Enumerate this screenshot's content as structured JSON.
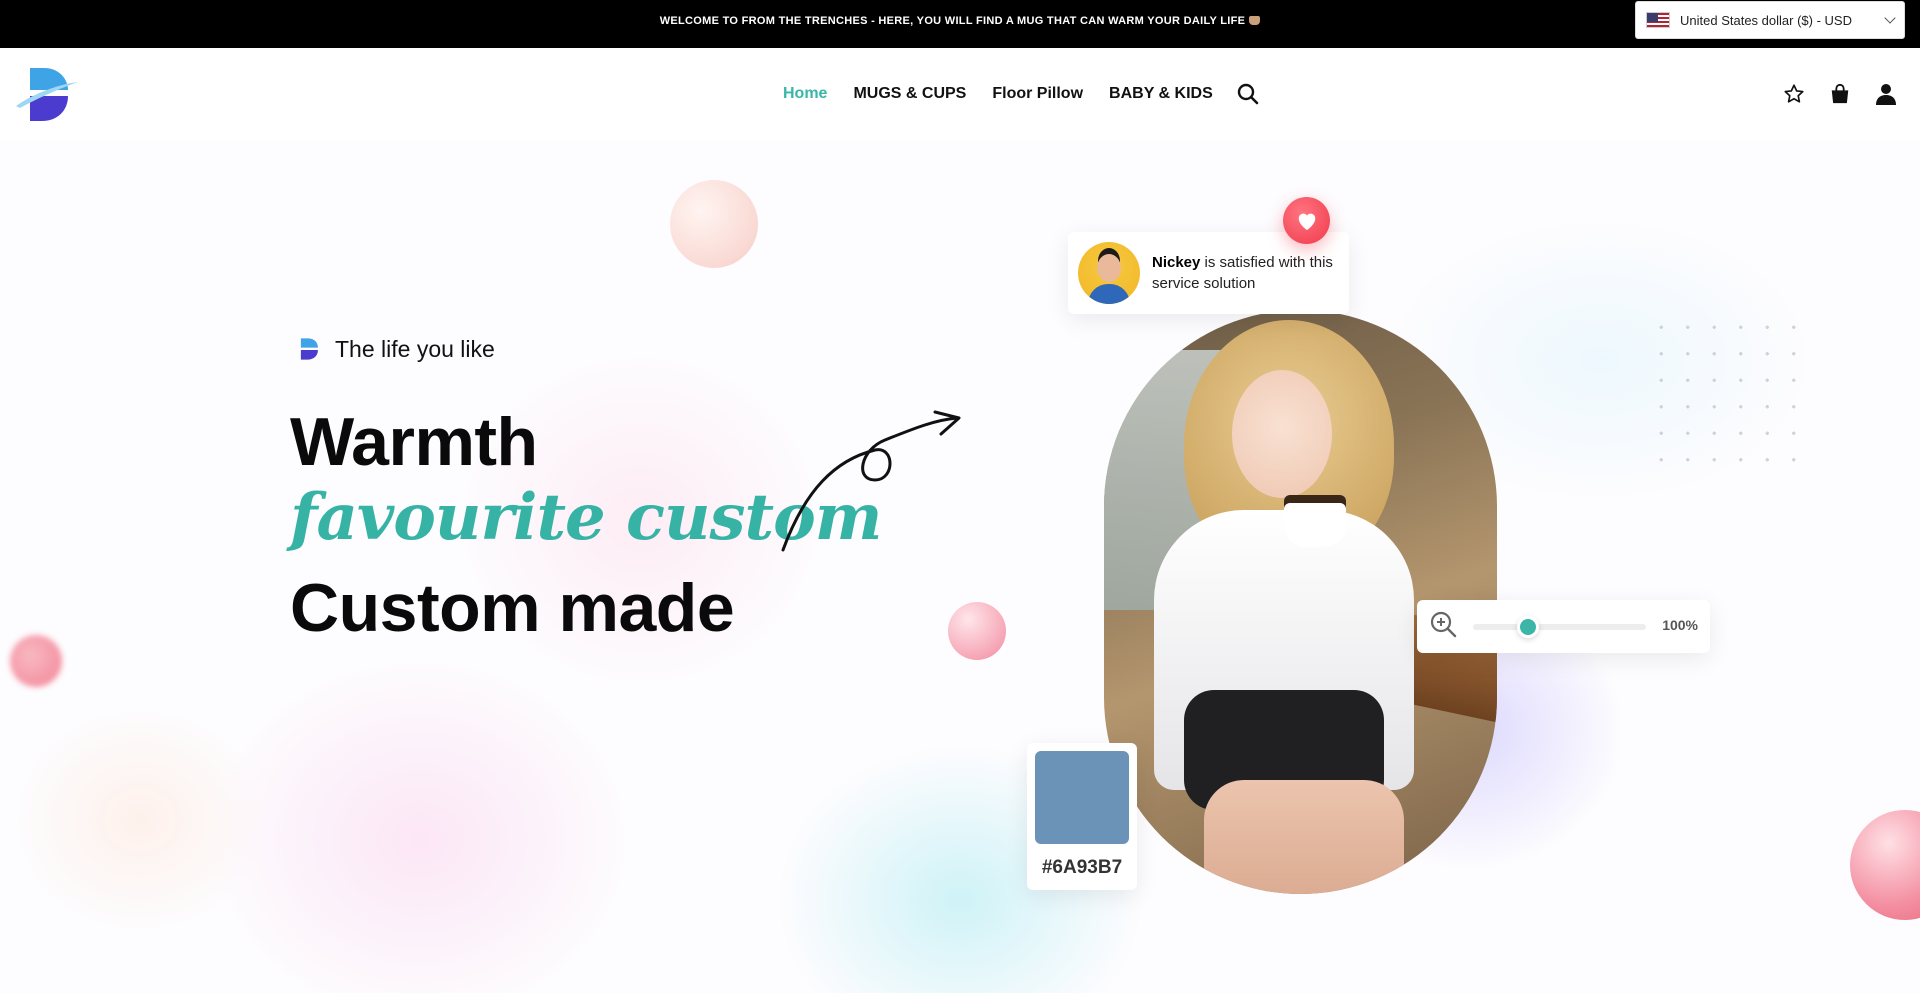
{
  "announcement": {
    "text": "WELCOME TO FROM THE TRENCHES - HERE, YOU WILL FIND A MUG THAT CAN WARM YOUR DAILY LIFE",
    "emoji_icon": "coffee-cup-icon"
  },
  "currency": {
    "selected": "United States dollar ($) - USD",
    "flag_icon": "us-flag-icon"
  },
  "header": {
    "nav": [
      {
        "label": "Home",
        "active": true
      },
      {
        "label": "MUGS & CUPS",
        "active": false
      },
      {
        "label": "Floor Pillow",
        "active": false
      },
      {
        "label": "BABY & KIDS",
        "active": false
      }
    ],
    "icons": [
      "search-icon",
      "wishlist-star-icon",
      "shopping-bag-icon",
      "account-icon"
    ]
  },
  "hero": {
    "eyebrow": "The life you like",
    "headline_line1": "Warmth",
    "headline_line2": "favourite custom",
    "headline_line3": "Custom made",
    "review": {
      "name": "Nickey",
      "text": " is satisfied with this service solution"
    },
    "zoom": {
      "value_label": "100%",
      "level": 0.32
    },
    "swatch": {
      "hex": "#6A93B7",
      "color": "#6A93B7"
    }
  },
  "colors": {
    "accent": "#3ab5a8",
    "heart": "#f03a4b",
    "announcement_bg": "#000000"
  }
}
